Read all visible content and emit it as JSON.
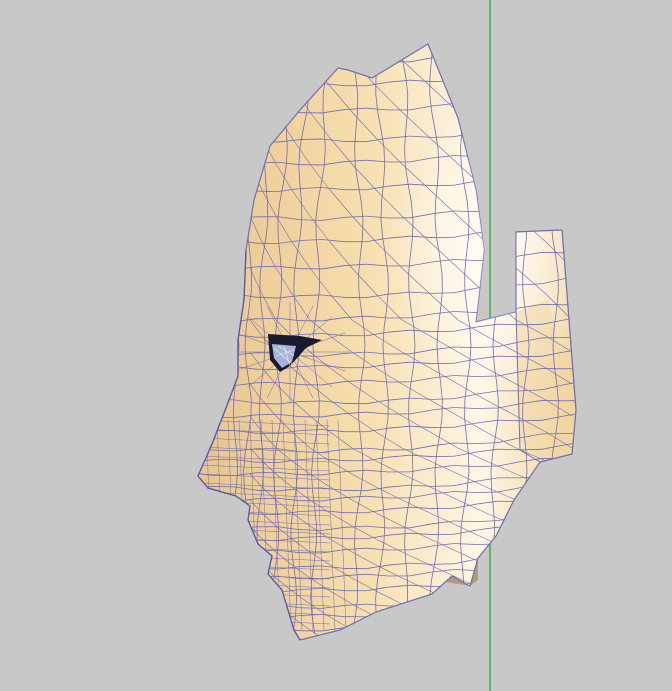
{
  "viewport": {
    "background_color": "#c8c8c8",
    "object": "head-mesh",
    "view": "side-profile-left",
    "render_mode": "shaded-wireframe",
    "skin_color": "#f7dca8",
    "highlight_color": "#fffaf0",
    "wire_color": "#6e6eb4",
    "axis_color": "#2ea82e",
    "eye_color": "#1a1a2e"
  }
}
